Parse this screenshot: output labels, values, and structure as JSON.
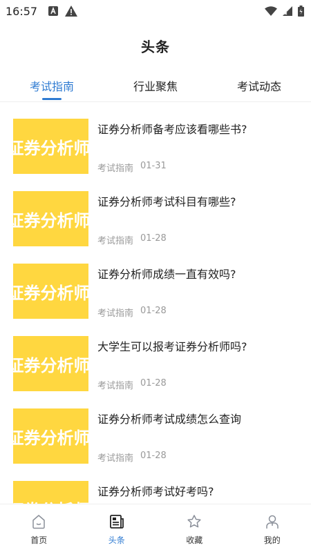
{
  "status_bar": {
    "time": "16:57",
    "left_icons": [
      "font-a-icon",
      "warning-icon"
    ],
    "right_icons": [
      "wifi-icon",
      "signal-icon",
      "battery-icon"
    ]
  },
  "header": {
    "title": "头条"
  },
  "tabs": [
    {
      "label": "考试指南",
      "active": true
    },
    {
      "label": "行业聚焦",
      "active": false
    },
    {
      "label": "考试动态",
      "active": false
    }
  ],
  "articles": [
    {
      "thumb_text": "证券分析师",
      "title": "证券分析师备考应该看哪些书?",
      "category": "考试指南",
      "date": "01-31"
    },
    {
      "thumb_text": "证券分析师",
      "title": "证券分析师考试科目有哪些?",
      "category": "考试指南",
      "date": "01-28"
    },
    {
      "thumb_text": "证券分析师",
      "title": "证券分析师成绩一直有效吗?",
      "category": "考试指南",
      "date": "01-28"
    },
    {
      "thumb_text": "证券分析师",
      "title": "大学生可以报考证券分析师吗?",
      "category": "考试指南",
      "date": "01-28"
    },
    {
      "thumb_text": "证券分析师",
      "title": "证券分析师考试成绩怎么查询",
      "category": "考试指南",
      "date": "01-28"
    },
    {
      "thumb_text": "证券分析师",
      "title": "证券分析师考试好考吗?",
      "category": "",
      "date": ""
    }
  ],
  "bottom_nav": [
    {
      "label": "首页",
      "icon": "home-icon",
      "active": false
    },
    {
      "label": "头条",
      "icon": "news-icon",
      "active": true
    },
    {
      "label": "收藏",
      "icon": "star-icon",
      "active": false
    },
    {
      "label": "我的",
      "icon": "user-icon",
      "active": false
    }
  ],
  "colors": {
    "accent": "#2f7bd2",
    "thumb_bg": "#ffd740",
    "meta_text": "#999999"
  }
}
